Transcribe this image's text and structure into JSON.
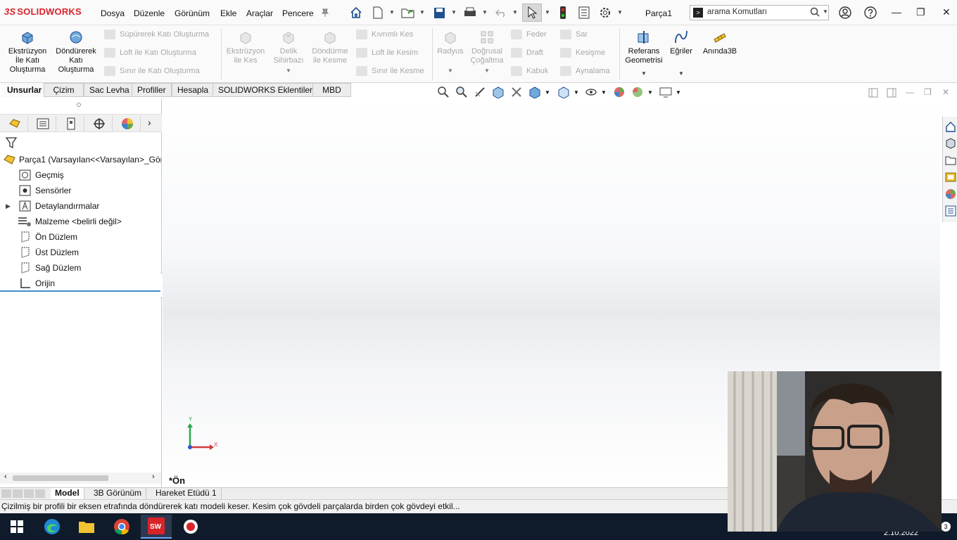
{
  "app": {
    "logo": "SOLIDWORKS",
    "doc_title": "Parça1"
  },
  "menu": [
    "Dosya",
    "Düzenle",
    "Görünüm",
    "Ekle",
    "Araçlar",
    "Pencere"
  ],
  "search": {
    "placeholder": "arama Komutları"
  },
  "features": {
    "extrude_boss": "Ekstrüzyon İle Katı Oluşturma",
    "revolve_boss": "Döndürerek Katı Oluşturma",
    "sweep_boss": "Süpürerek Katı Oluşturma",
    "loft_boss": "Loft ile Katı Oluşturma",
    "boundary_boss": "Sınır ile Katı Oluşturma",
    "extrude_cut": "Ekstrüzyon ile Kes",
    "hole_wizard": "Delik Sihirbazı",
    "revolve_cut": "Döndürme ile Kesme",
    "sweep_cut": "Kıvrımlı Kes",
    "loft_cut": "Loft ile Kesim",
    "boundary_cut": "Sınır ile Kesme",
    "fillet": "Radyus",
    "linear_pattern": "Doğrusal Çoğaltma",
    "rib": "Feder",
    "draft": "Draft",
    "shell": "Kabuk",
    "wrap": "Sar",
    "intersect": "Kesişme",
    "mirror": "Aynalama",
    "ref_geometry": "Referans Geometrisi",
    "curves": "Eğriler",
    "instant3d": "Anında3B"
  },
  "tabs": [
    "Unsurlar",
    "Çizim",
    "Sac Levha",
    "Profiller",
    "Hesapla",
    "SOLIDWORKS Eklentileri",
    "MBD"
  ],
  "tree": {
    "root": "Parça1  (Varsayılan<<Varsayılan>_Gör",
    "items": [
      "Geçmiş",
      "Sensörler",
      "Detaylandırmalar",
      "Malzeme <belirli değil>",
      "Ön Düzlem",
      "Üst Düzlem",
      "Sağ Düzlem",
      "Orijin"
    ]
  },
  "triad": {
    "x": "X",
    "y": "Y"
  },
  "view_name": "*Ön",
  "bottom_tabs": [
    "Model",
    "3B Görünüm",
    "Hareket Etüdü 1"
  ],
  "status": "Çizilmiş bir profili bir eksen etrafında döndürerek katı modeli keser. Kesim çok gövdeli parçalarda birden çok gövdeyi etkil...",
  "clock": "2.10.2022",
  "taskbar_badge": "3",
  "colors": {
    "brand": "#d8232a",
    "selection_line": "#3d8fd0",
    "taskbar": "#0f1b2b"
  }
}
